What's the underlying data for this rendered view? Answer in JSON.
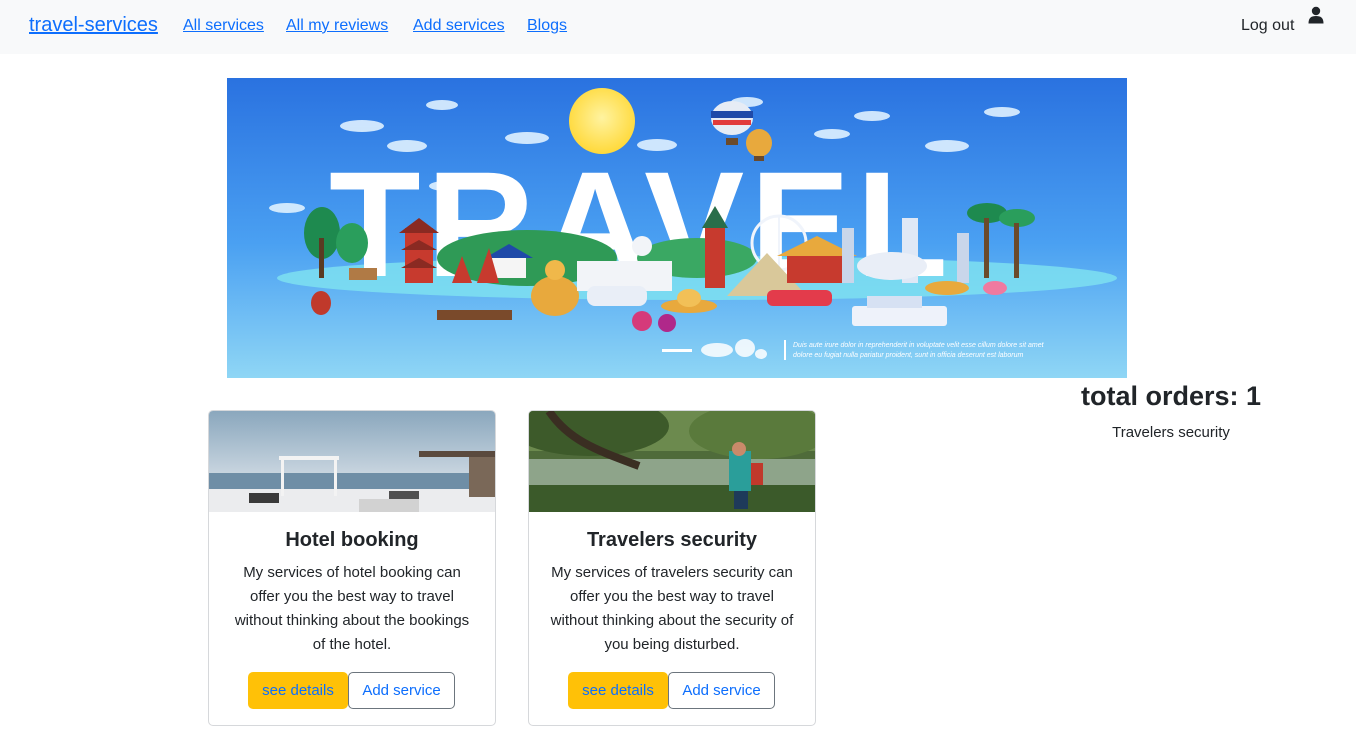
{
  "navbar": {
    "brand": "travel-services",
    "links": [
      "All services",
      "All my reviews",
      "Add services",
      "Blogs"
    ],
    "logout": "Log out",
    "user_icon": "user-icon"
  },
  "banner": {
    "title": "TRAVEL",
    "caption_line1": "Duis aute irure dolor in reprehenderit in voluptate velit esse cillum dolore sit amet",
    "caption_line2": "dolore eu fugiat nulla pariatur proident, sunt in officia deserunt est laborum",
    "colors": {
      "sky": "#2f7fe6",
      "sea": "#8fd6f5"
    }
  },
  "orders": {
    "title": "total orders: 1",
    "items": [
      "Travelers security"
    ]
  },
  "cards": [
    {
      "title": "Hotel booking",
      "description": "My services of hotel booking can offer you the best way to travel without thinking about the bookings of the hotel.",
      "details_label": "see details",
      "add_label": "Add service"
    },
    {
      "title": "Travelers security",
      "description": "My services of travelers security can offer you the best way to travel without thinking about the security of you being disturbed.",
      "details_label": "see details",
      "add_label": "Add service"
    }
  ],
  "colors": {
    "link": "#0d6efd",
    "accent": "#ffc107",
    "navbar_bg": "#f8f9fa"
  }
}
